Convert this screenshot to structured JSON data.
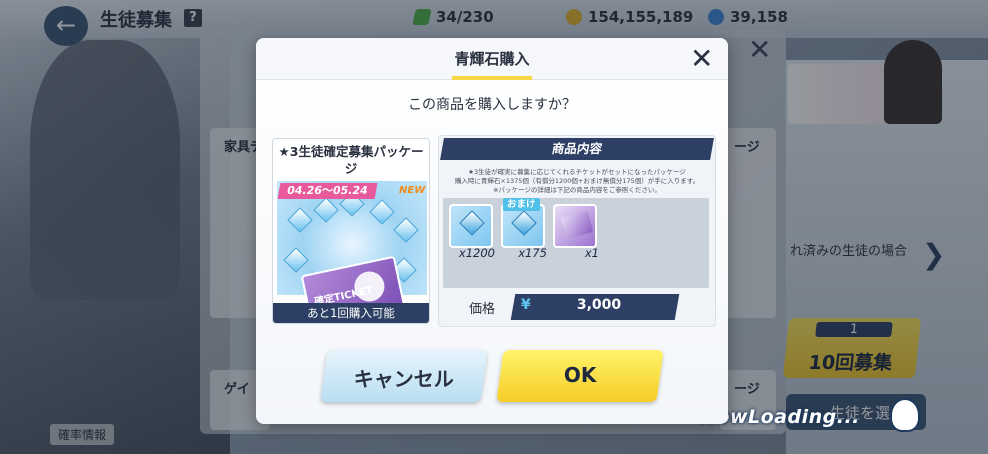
{
  "top_bar": {
    "back_icon": "arrow-left-icon",
    "page_title": "生徒募集",
    "help_icon": "help-icon",
    "ap": "34/230",
    "credits": "154,155,189",
    "pyroxene": "39,158"
  },
  "background": {
    "left_card_title": "家具デ",
    "left_card_bottom": "ゲイ",
    "right_card_title": "ージ",
    "right_card_bottom": "ージ",
    "right_text": "れ済みの生徒の場合",
    "gacha10_count": "1",
    "gacha10_label": "10回募集",
    "select_button": "生徒を選",
    "rate_info": "確率情報",
    "now_loading": "NowLoading..."
  },
  "dialog": {
    "title": "青輝石購入",
    "question": "この商品を購入しますか？",
    "product": {
      "name": "★3生徒確定募集パッケージ",
      "dates": "04.26～05.24",
      "new_badge": "NEW",
      "ticket_text": "確定TICKET",
      "remaining": "あと1回購入可能"
    },
    "contents": {
      "header": "商品内容",
      "desc_line1": "★3生徒が確実に募集に応じてくれるチケットがセットになったパッケージ",
      "desc_line2": "購入時に青輝石×1375個（有償分1200個+おまけ無償分175個）が手に入ります。",
      "desc_line3": "※パッケージの詳細は下記の商品内容をご参照ください。",
      "items": [
        {
          "icon": "pyroxene-icon",
          "qty": "x1200"
        },
        {
          "icon": "pyroxene-icon",
          "qty": "x175",
          "tag": "おまけ"
        },
        {
          "icon": "recruit-ticket-icon",
          "qty": "x1"
        }
      ],
      "price_label": "価格",
      "currency": "¥",
      "price": "3,000"
    },
    "cancel_label": "キャンセル",
    "ok_label": "OK"
  }
}
